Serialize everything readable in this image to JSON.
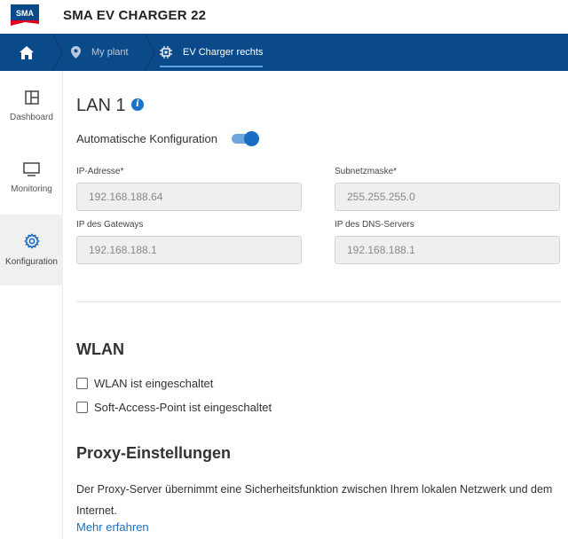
{
  "header": {
    "logo_text": "SMA",
    "title": "SMA EV CHARGER 22"
  },
  "breadcrumb": {
    "home_icon": "home-icon",
    "items": [
      {
        "label": "My plant",
        "icon": "map-pin-icon"
      },
      {
        "label": "EV Charger rechts",
        "icon": "chip-icon"
      }
    ]
  },
  "sidebar": {
    "items": [
      {
        "label": "Dashboard",
        "icon": "dashboard-icon",
        "active": false
      },
      {
        "label": "Monitoring",
        "icon": "monitor-icon",
        "active": false
      },
      {
        "label": "Konfiguration",
        "icon": "gear-icon",
        "active": true
      }
    ]
  },
  "lan": {
    "title": "LAN 1",
    "info_icon": "i",
    "auto_config_label": "Automatische Konfiguration",
    "auto_config_enabled": true,
    "fields": [
      {
        "label": "IP-Adresse*",
        "value": "192.168.188.64"
      },
      {
        "label": "Subnetzmaske*",
        "value": "255.255.255.0"
      },
      {
        "label": "IP des Gateways",
        "value": "192.168.188.1"
      },
      {
        "label": "IP des DNS-Servers",
        "value": "192.168.188.1"
      }
    ]
  },
  "wlan": {
    "title": "WLAN",
    "options": [
      {
        "label": "WLAN ist eingeschaltet",
        "checked": false
      },
      {
        "label": "Soft-Access-Point ist eingeschaltet",
        "checked": false
      }
    ]
  },
  "proxy": {
    "title": "Proxy-Einstellungen",
    "description": "Der Proxy-Server übernimmt eine Sicherheitsfunktion zwischen Ihrem lokalen Netzwerk und dem Internet.",
    "link": "Mehr erfahren"
  },
  "colors": {
    "navbar": "#0b4a89",
    "accent": "#1a6ec4",
    "logo_red": "#e2001a",
    "logo_blue": "#0b4a89"
  }
}
